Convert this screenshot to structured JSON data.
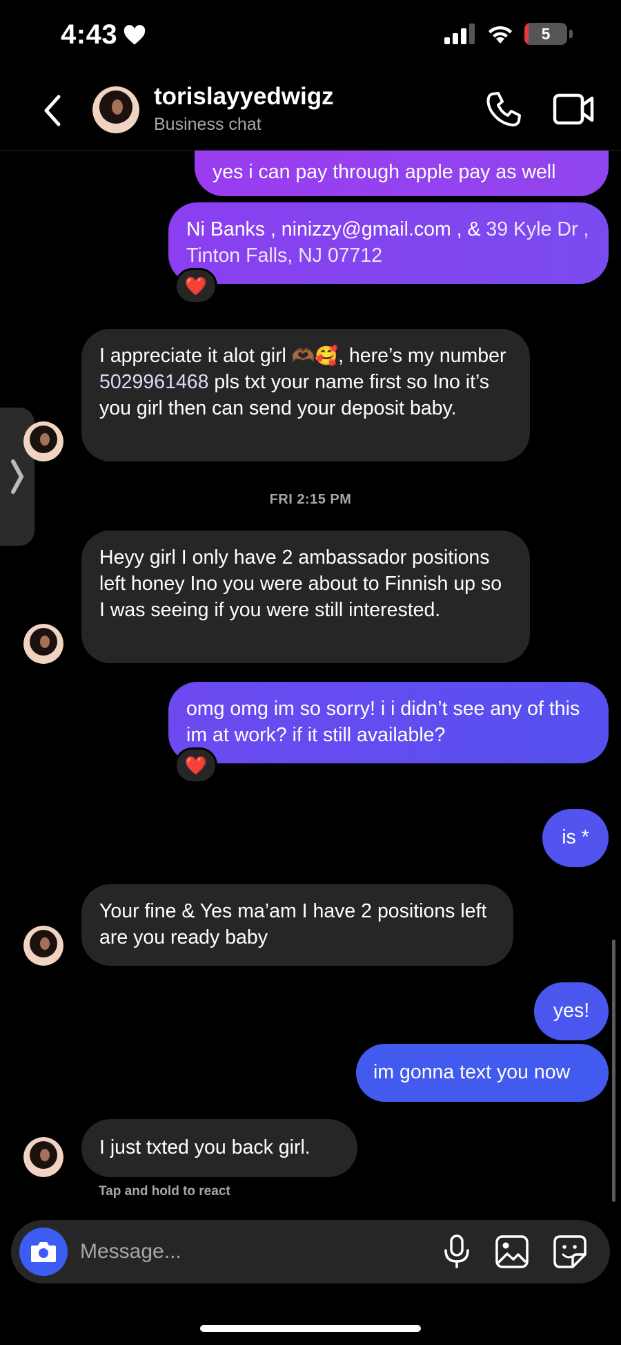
{
  "status_bar": {
    "time": "4:43",
    "battery": "5",
    "battery_level_percent": 5,
    "battery_color": "#e03b3b"
  },
  "header": {
    "title": "torislayyedwigz",
    "subtitle": "Business chat"
  },
  "messages": [
    {
      "dir": "out",
      "text": "yes i can pay through apple pay as well"
    },
    {
      "dir": "out",
      "text_parts": [
        "Ni Banks , ninizzy@gmail.com , & ",
        "39 Kyle Dr , Tinton Falls, NJ 07712"
      ],
      "reaction": "❤️"
    },
    {
      "dir": "in",
      "text_parts": [
        "I appreciate it alot girl ",
        "🫶🏾🥰",
        ",  here’s my number ",
        "5029961468",
        " pls txt your name first so Ino it’s you girl then can send your deposit baby."
      ]
    },
    {
      "dir": "in",
      "text": "Heyy girl I only have 2 ambassador positions left honey Ino you were about to Finnish up so I was seeing if you were still interested."
    },
    {
      "dir": "out",
      "text": "omg omg im so sorry! i i didn’t see any of this im at work? if it still available?",
      "reaction": "❤️"
    },
    {
      "dir": "out",
      "text": "is *"
    },
    {
      "dir": "in",
      "text": "Your fine & Yes ma’am I have 2 positions left are you ready baby"
    },
    {
      "dir": "out",
      "text": "yes!"
    },
    {
      "dir": "out",
      "text": "im gonna text you now"
    },
    {
      "dir": "in",
      "text": "I just txted you back girl."
    }
  ],
  "timestamp": "FRI 2:15 PM",
  "react_hint": "Tap and hold to react",
  "composer": {
    "placeholder": "Message..."
  },
  "colors": {
    "incoming_bubble": "#262626",
    "outgoing_gradient": [
      "#a23df0",
      "#3f5cf0"
    ],
    "camera_button": "#3d5cf3"
  },
  "icons": [
    "back-chevron-icon",
    "phone-icon",
    "video-camera-icon",
    "camera-icon",
    "microphone-icon",
    "gallery-icon",
    "sticker-icon",
    "heart-icon"
  ]
}
